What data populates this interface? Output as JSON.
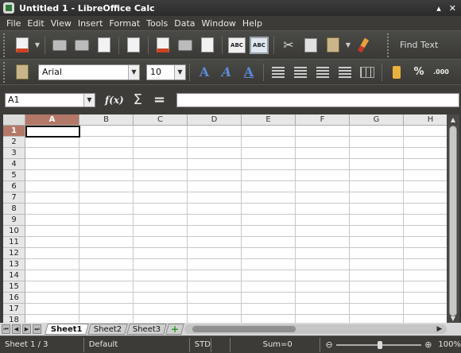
{
  "window": {
    "title": "Untitled 1 - LibreOffice Calc",
    "minimize": "▴",
    "close": "✕"
  },
  "menu": [
    "File",
    "Edit",
    "View",
    "Insert",
    "Format",
    "Tools",
    "Data",
    "Window",
    "Help"
  ],
  "toolbar": {
    "find_text_label": "Find Text",
    "spell_label": "ABC",
    "autospell_label": "ABC"
  },
  "formatting": {
    "font_name": "Arial",
    "font_size": "10",
    "percent_label": "%",
    "decimal_label": ".000"
  },
  "formula_bar": {
    "cell_reference": "A1",
    "fx_label": "f(x)",
    "sigma_label": "Σ",
    "equals_label": "=",
    "formula": ""
  },
  "sheet": {
    "columns": [
      "A",
      "B",
      "C",
      "D",
      "E",
      "F",
      "G",
      "H"
    ],
    "rows": [
      "1",
      "2",
      "3",
      "4",
      "5",
      "6",
      "7",
      "8",
      "9",
      "10",
      "11",
      "12",
      "13",
      "14",
      "15",
      "16",
      "17",
      "18"
    ],
    "selected_column": "A",
    "selected_row": "1"
  },
  "tabs": [
    "Sheet1",
    "Sheet2",
    "Sheet3"
  ],
  "active_tab": "Sheet1",
  "status": {
    "sheet_position": "Sheet 1 / 3",
    "page_style": "Default",
    "selection_mode": "STD",
    "sum": "Sum=0",
    "zoom": "100%"
  },
  "colors": {
    "selection_header": "#b37868",
    "accent_blue": "#5c8bd6"
  }
}
